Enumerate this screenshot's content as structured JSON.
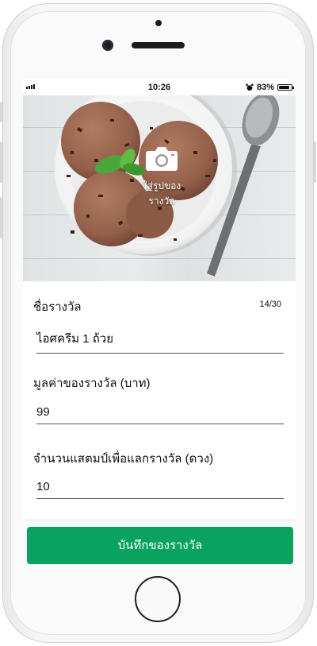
{
  "status_bar": {
    "time": "10:26",
    "battery": "83%"
  },
  "photo": {
    "upload_label": "ใส่รูปของรางวัล"
  },
  "form": {
    "name": {
      "title": "ชื่อรางวัล",
      "counter": "14/30",
      "value": "ไอศครีม 1 ถ้วย"
    },
    "value": {
      "title": "มูลค่าของรางวัล (บาท)",
      "value": "99"
    },
    "stamps": {
      "title": "จำนวนแสตมป์เพื่อแลกรางวัล (ดวง)",
      "value": "10"
    }
  },
  "actions": {
    "save_label": "บันทึกของรางวัล"
  },
  "colors": {
    "primary": "#09a25f",
    "icecream": "#9a6449"
  }
}
